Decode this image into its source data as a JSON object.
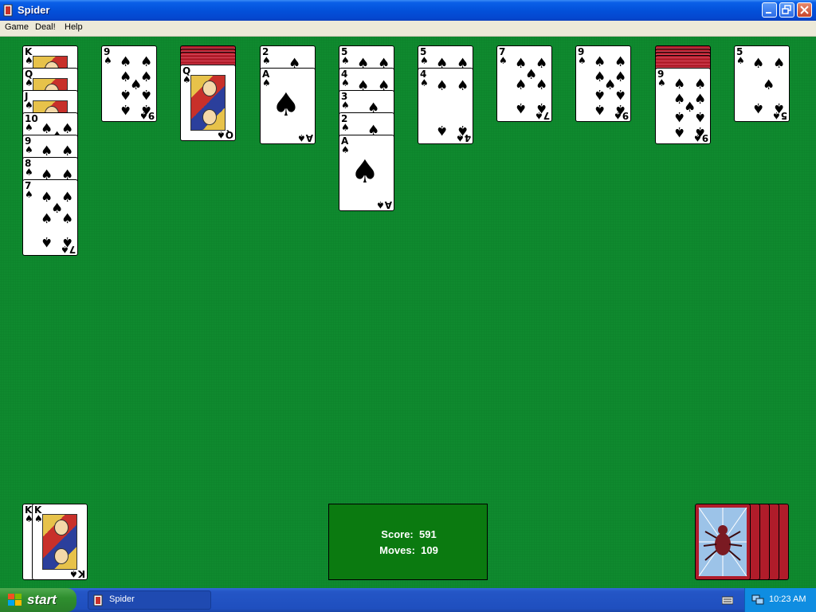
{
  "window": {
    "title": "Spider"
  },
  "menu": {
    "items": [
      "Game",
      "Deal!",
      "Help"
    ]
  },
  "score": {
    "score_label": "Score:",
    "score_value": "591",
    "moves_label": "Moves:",
    "moves_value": "109"
  },
  "taskbar": {
    "start_label": "start",
    "task_label": "Spider",
    "clock": "10:23 AM"
  },
  "colors": {
    "felt": "#0f8a2e",
    "score_box": "#0b7a10",
    "card_back": "#b01c2a"
  },
  "suit_symbol": "♠",
  "tableau": [
    {
      "hidden": 0,
      "cards": [
        "K",
        "Q",
        "J",
        "10",
        "9",
        "8",
        "7"
      ]
    },
    {
      "hidden": 0,
      "cards": [
        "9"
      ]
    },
    {
      "hidden": 3,
      "cards": [
        "Q"
      ]
    },
    {
      "hidden": 0,
      "cards": [
        "2",
        "A"
      ]
    },
    {
      "hidden": 0,
      "cards": [
        "5",
        "4",
        "3",
        "2",
        "A"
      ]
    },
    {
      "hidden": 0,
      "cards": [
        "5",
        "4"
      ]
    },
    {
      "hidden": 0,
      "cards": [
        "7"
      ]
    },
    {
      "hidden": 0,
      "cards": [
        "9"
      ]
    },
    {
      "hidden": 4,
      "cards": [
        "9"
      ]
    },
    {
      "hidden": 0,
      "cards": [
        "5"
      ]
    }
  ],
  "foundation": {
    "completed_runs": 2,
    "top_rank": "K"
  },
  "stock": {
    "remaining_deals": 5
  }
}
